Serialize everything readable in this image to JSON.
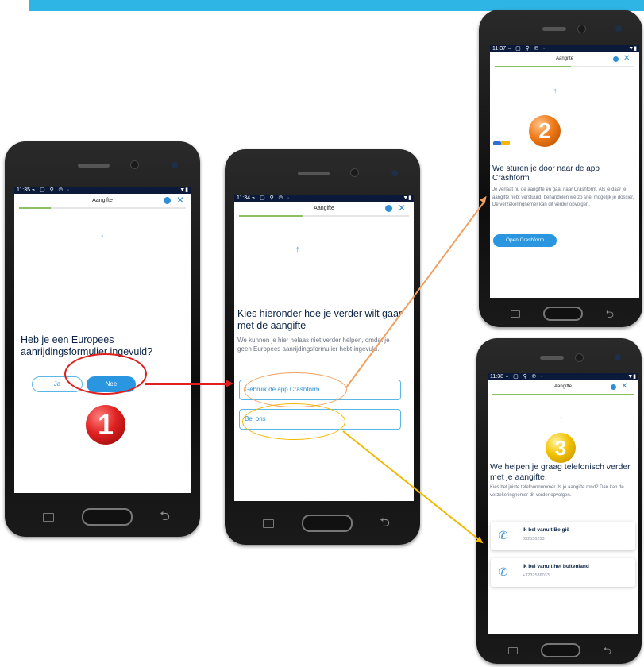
{
  "phone1": {
    "time": "11:35",
    "status_icons": "⌁ ▢ ⚲ ℗ ·",
    "right_icons": "▼▮",
    "header_title": "Aangifte",
    "close_glyph": "✕",
    "arrow_glyph": "↑",
    "question": "Heb je een Europees aanrijdingsformulier ingevuld?",
    "yes_label": "Ja",
    "no_label": "Nee",
    "badge": "1"
  },
  "phone2": {
    "time": "11:34",
    "status_icons": "⌁ ▢ ⚲ ℗ ·",
    "right_icons": "▼▮",
    "header_title": "Aangifte",
    "close_glyph": "✕",
    "arrow_glyph": "↑",
    "title": "Kies hieronder hoe je verder wilt gaan met de aangifte",
    "body": "We kunnen je hier helaas niet verder helpen, omdat je geen Europees aanrijdingsformulier hebt ingevuld.",
    "option1": "Gebruik de app Crashform",
    "option2": "Bel ons"
  },
  "phone3": {
    "time": "11:37",
    "status_icons": "⌁ ▢ ⚲ ℗ ·",
    "right_icons": "▼▮",
    "header_title": "Aangifte",
    "close_glyph": "✕",
    "arrow_glyph": "↑",
    "title": "We sturen je door naar de app Crashform",
    "body": "Je verlaat nu de aangifte en gaat naar Crashform. Als je daar je aangifte hebt verstuurd, behandelen we zo snel mogelijk je dossier. De verzekeringnemer kan dit verder opvolgen.",
    "button": "Open Crashform",
    "badge": "2"
  },
  "phone4": {
    "time": "11:38",
    "status_icons": "⌁ ▢ ⚲ ℗ ·",
    "right_icons": "▼▮",
    "header_title": "Aangifte",
    "close_glyph": "✕",
    "arrow_glyph": "↑",
    "title": "We helpen je graag telefonisch verder met je aangifte.",
    "body": "Kies het juiste telefoonnummer. Is je aangifte rond? Dan kan de verzekeringnemer dit verder opvolgen.",
    "call1_label": "Ik bel vanuit België",
    "call1_number": "032536253",
    "call2_label": "Ik bel vanuit het buitenland",
    "call2_number": "+3232536033",
    "badge": "3"
  },
  "colors": {
    "accent_blue": "#2fb4e6",
    "annotation_red": "#e02020",
    "annotation_orange": "#f0a060",
    "annotation_yellow": "#f2b800"
  }
}
